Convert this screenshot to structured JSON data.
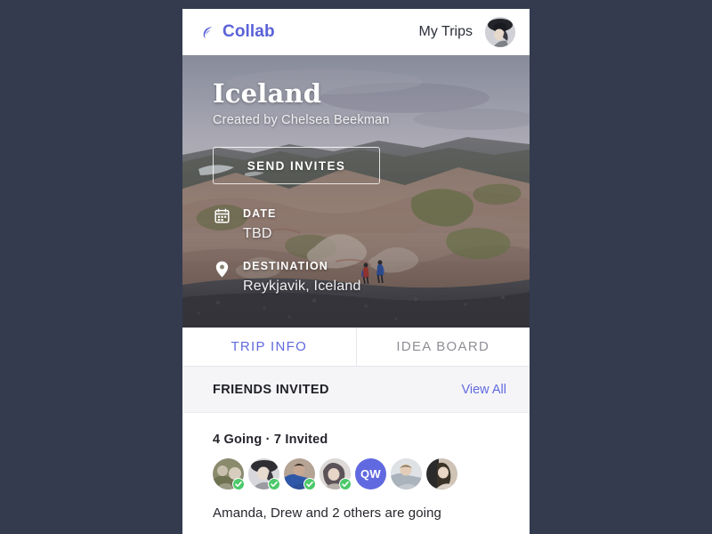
{
  "theme": {
    "page_background": "#343b4f",
    "accent": "#6169e0",
    "brand_color": "#5b62d8",
    "going_badge_color": "#4cc96a",
    "band_background": "#f5f5f7"
  },
  "topbar": {
    "brand_name": "Collab",
    "brand_icon": "collab-moon-icon",
    "my_trips_label": "My Trips",
    "avatar_icon": "user-avatar"
  },
  "hero": {
    "title": "Iceland",
    "subtitle": "Created by Chelsea Beekman",
    "invite_button_label": "SEND INVITES",
    "meta": [
      {
        "icon": "calendar-icon",
        "label": "DATE",
        "value": "TBD"
      },
      {
        "icon": "location-pin-icon",
        "label": "DESTINATION",
        "value": "Reykjavik, Iceland"
      }
    ]
  },
  "tabs": [
    {
      "label": "TRIP INFO",
      "active": true
    },
    {
      "label": "IDEA BOARD",
      "active": false
    }
  ],
  "friends": {
    "section_title": "FRIENDS INVITED",
    "view_all_label": "View All",
    "count_line": "4 Going · 7 Invited",
    "going_count": 4,
    "invited_count": 7,
    "summary": "Amanda, Drew and 2 others are going",
    "avatars": [
      {
        "type": "photo",
        "going": true,
        "tone_a": "#8a8a6d",
        "tone_b": "#c8bfae"
      },
      {
        "type": "photo",
        "going": true,
        "tone_a": "#3a3a40",
        "tone_b": "#d8d8dc"
      },
      {
        "type": "photo",
        "going": true,
        "tone_a": "#2f57a8",
        "tone_b": "#c7a893"
      },
      {
        "type": "photo",
        "going": true,
        "tone_a": "#5c5358",
        "tone_b": "#ddd9d6"
      },
      {
        "type": "initials",
        "going": false,
        "initials": "QW"
      },
      {
        "type": "photo",
        "going": false,
        "tone_a": "#9aa3ad",
        "tone_b": "#e2e4e6"
      },
      {
        "type": "photo",
        "going": false,
        "tone_a": "#2b2b2b",
        "tone_b": "#cfc3b6"
      }
    ]
  }
}
